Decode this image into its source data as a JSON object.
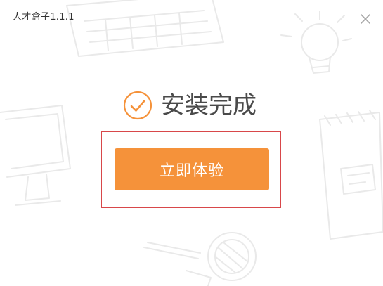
{
  "window": {
    "title": "人才盒子1.1.1"
  },
  "status": {
    "text": "安装完成",
    "icon": "check-circle-icon"
  },
  "actions": {
    "start_label": "立即体验"
  },
  "icons": {
    "close": "close-icon"
  },
  "colors": {
    "accent": "#f5923a",
    "highlight_border": "#d8474a",
    "text": "#4a4a4a"
  }
}
